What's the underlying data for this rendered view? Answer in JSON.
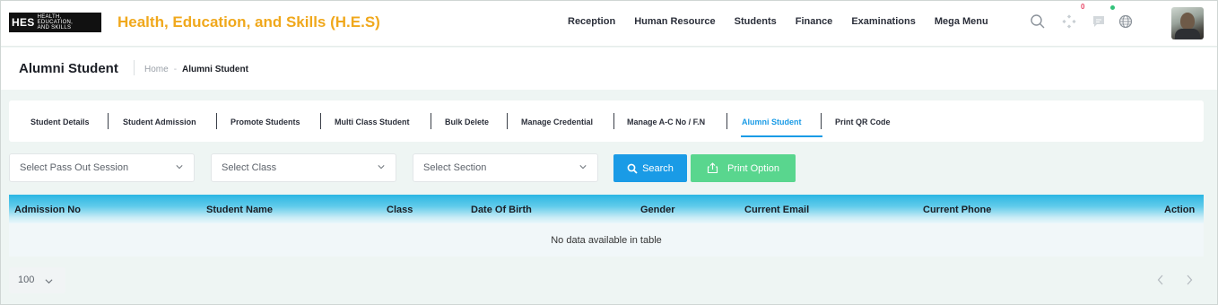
{
  "logo": {
    "mark": "HES",
    "sub": [
      "HEALTH,",
      "EDUCATION,",
      "AND SKILLS"
    ]
  },
  "app_title": "Health, Education, and Skills (H.E.S)",
  "topnav": [
    "Reception",
    "Human Resource",
    "Students",
    "Finance",
    "Examinations",
    "Mega Menu"
  ],
  "header_icons": {
    "notifications_count": "0"
  },
  "colors": {
    "accent": "#1a9be6",
    "brand": "#f0a81c",
    "print_button": "#59d68e",
    "badge": "#e84a6a",
    "online_dot": "#33c27a"
  },
  "page": {
    "title": "Alumni Student",
    "breadcrumb_home": "Home",
    "breadcrumb_sep": "-",
    "breadcrumb_current": "Alumni Student"
  },
  "tabs": [
    "Student Details",
    "Student Admission",
    "Promote Students",
    "Multi Class Student",
    "Bulk Delete",
    "Manage Credential",
    "Manage A-C No / F.N",
    "Alumni Student",
    "Print QR Code"
  ],
  "active_tab": "Alumni Student",
  "filters": {
    "pass_out_session": "Select Pass Out Session",
    "class": "Select Class",
    "section": "Select Section"
  },
  "buttons": {
    "search": "Search",
    "print": "Print Option"
  },
  "table": {
    "columns": [
      "Admission No",
      "Student Name",
      "Class",
      "Date Of Birth",
      "Gender",
      "Current Email",
      "Current Phone",
      "Action"
    ],
    "empty_message": "No data available in table"
  },
  "page_size": "100"
}
